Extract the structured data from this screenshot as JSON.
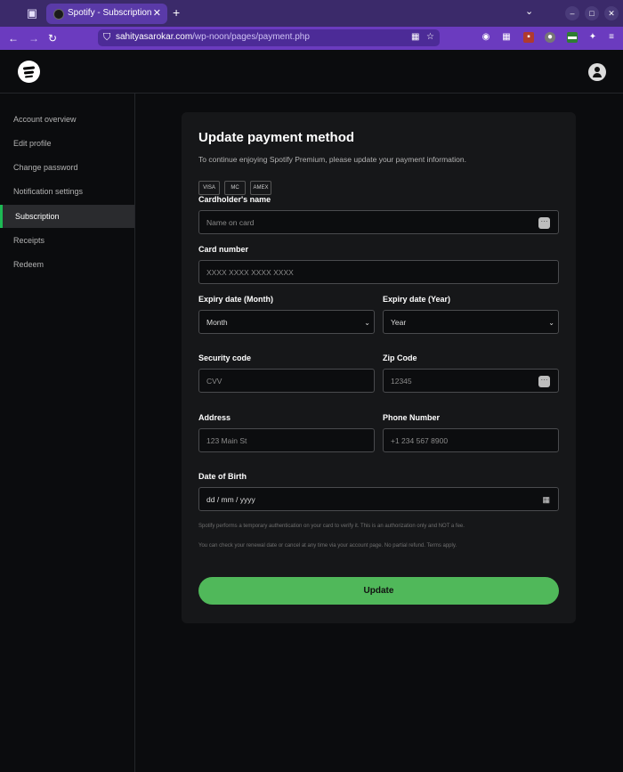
{
  "browser": {
    "tab_title": "Spotify - Subscription",
    "url_host": "sahityasarokar.com",
    "url_path": "/wp-noon/pages/payment.php"
  },
  "sidebar": {
    "items": [
      {
        "label": "Account overview"
      },
      {
        "label": "Edit profile"
      },
      {
        "label": "Change password"
      },
      {
        "label": "Notification settings"
      },
      {
        "label": "Subscription",
        "active": true
      },
      {
        "label": "Receipts"
      },
      {
        "label": "Redeem"
      }
    ]
  },
  "form": {
    "title": "Update payment method",
    "subtitle": "To continue enjoying Spotify Premium, please update your payment information.",
    "card_badges": [
      "VISA",
      "MC",
      "AMEX"
    ],
    "cardholder_label": "Cardholder's name",
    "cardholder_placeholder": "Name on card",
    "card_number_label": "Card number",
    "card_number_placeholder": "XXXX XXXX XXXX XXXX",
    "expiry_month_label": "Expiry date (Month)",
    "expiry_month_value": "Month",
    "expiry_year_label": "Expiry date (Year)",
    "expiry_year_value": "Year",
    "security_label": "Security code",
    "security_placeholder": "CVV",
    "zip_label": "Zip Code",
    "zip_placeholder": "12345",
    "address_label": "Address",
    "address_placeholder": "123 Main St",
    "phone_label": "Phone Number",
    "phone_placeholder": "+1 234 567 8900",
    "dob_label": "Date of Birth",
    "dob_placeholder": "dd / mm / yyyy",
    "note_1": "Spotify performs a temporary authentication on your card to verify it. This is an authorization only and NOT a fee.",
    "note_2": "You can check your renewal date or cancel at any time via your account page. No partial refund. Terms apply.",
    "submit_label": "Update"
  },
  "colors": {
    "accent": "#50b85a",
    "card_bg": "#161719",
    "page_bg": "#0b0c0e"
  }
}
